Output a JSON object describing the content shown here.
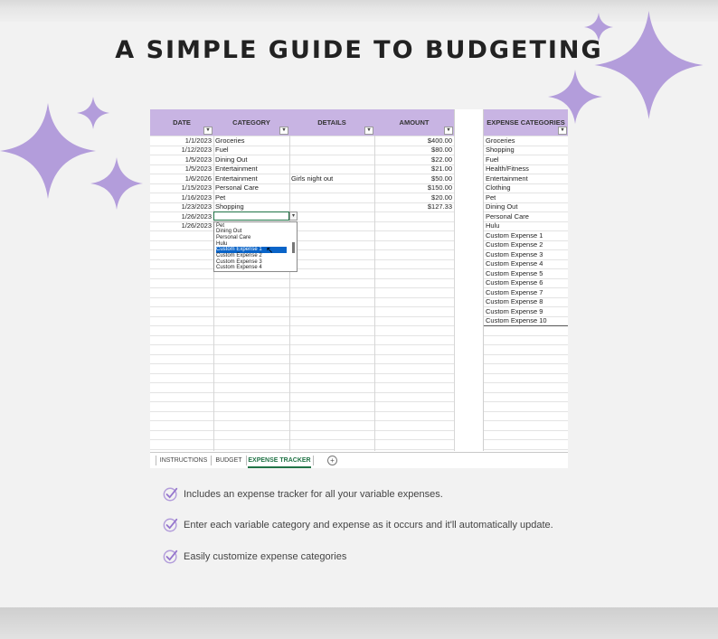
{
  "page": {
    "title": "A SIMPLE GUIDE TO BUDGETING",
    "accent_color": "#c8b4e3",
    "sparkle_color": "#b39ddb"
  },
  "spreadsheet": {
    "headers": {
      "date": "DATE",
      "category": "CATEGORY",
      "details": "DETAILS",
      "amount": "AMOUNT",
      "expense_categories": "EXPENSE CATEGORIES"
    },
    "rows": [
      {
        "date": "1/1/2023",
        "category": "Groceries",
        "details": "",
        "amount": "$400.00"
      },
      {
        "date": "1/12/2023",
        "category": "Fuel",
        "details": "",
        "amount": "$80.00"
      },
      {
        "date": "1/5/2023",
        "category": "Dining Out",
        "details": "",
        "amount": "$22.00"
      },
      {
        "date": "1/5/2023",
        "category": "Entertainment",
        "details": "",
        "amount": "$21.00"
      },
      {
        "date": "1/6/2026",
        "category": "Entertainment",
        "details": "Girls night out",
        "amount": "$50.00"
      },
      {
        "date": "1/15/2023",
        "category": "Personal Care",
        "details": "",
        "amount": "$150.00"
      },
      {
        "date": "1/16/2023",
        "category": "Pet",
        "details": "",
        "amount": "$20.00"
      },
      {
        "date": "1/23/2023",
        "category": "Shopping",
        "details": "",
        "amount": "$127.33"
      },
      {
        "date": "1/26/2023",
        "category": "",
        "details": "",
        "amount": ""
      },
      {
        "date": "1/26/2023",
        "category": "",
        "details": "",
        "amount": ""
      }
    ],
    "expense_categories": [
      "Groceries",
      "Shopping",
      "Fuel",
      "Health/Fitness",
      "Entertainment",
      "Clothing",
      "Pet",
      "Dining Out",
      "Personal Care",
      "Hulu",
      "Custom Expense 1",
      "Custom Expense 2",
      "Custom Expense 3",
      "Custom Expense 4",
      "Custom Expense 5",
      "Custom Expense 6",
      "Custom Expense 7",
      "Custom Expense 8",
      "Custom Expense 9",
      "Custom Expense 10"
    ],
    "dropdown_options": [
      "Pet",
      "Dining Out",
      "Personal Care",
      "Hulu",
      "Custom Expense 1",
      "Custom Expense 2",
      "Custom Expense 3",
      "Custom Expense 4"
    ],
    "dropdown_selected": "Custom Expense 1",
    "sheet_tabs": [
      "INSTRUCTIONS",
      "BUDGET",
      "EXPENSE TRACKER"
    ],
    "active_tab": "EXPENSE TRACKER"
  },
  "features": [
    "Includes an expense tracker for all your variable expenses.",
    "Enter each variable category and expense as it occurs and it'll automatically update.",
    "Easily customize expense categories"
  ],
  "icons": {
    "sparkle": "sparkle-icon",
    "check": "check-circle-icon",
    "filter": "filter-dropdown-icon",
    "add_sheet": "plus-circle-icon",
    "cursor": "pointer-cursor-icon"
  }
}
